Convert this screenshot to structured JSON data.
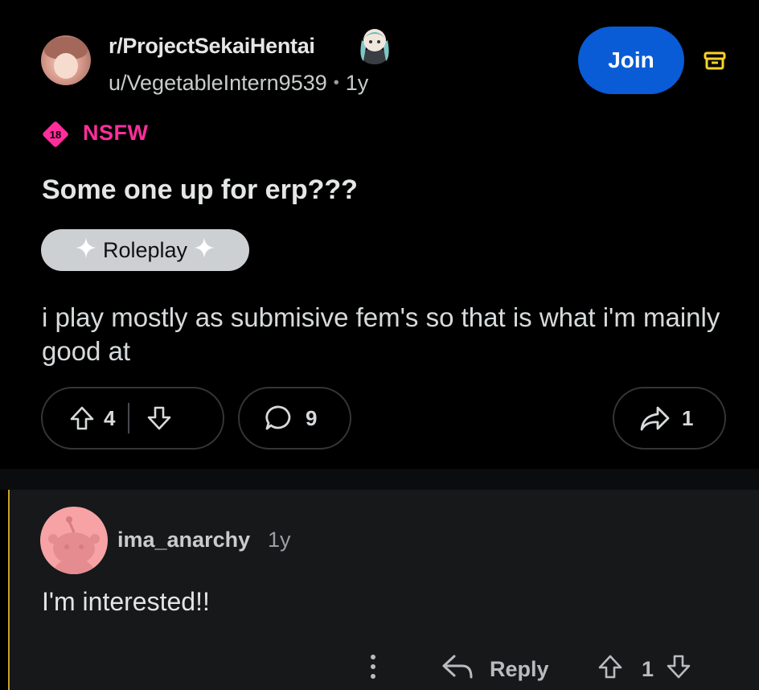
{
  "post": {
    "subreddit": "r/ProjectSekaiHentai",
    "author": "u/VegetableIntern9539",
    "separator": "•",
    "age": "1y",
    "join_label": "Join",
    "nsfw_badge": "18",
    "nsfw_label": "NSFW",
    "title": "Some one up for erp???",
    "flair": "Roleplay",
    "body": "i play mostly as submisive fem's so that is what i'm mainly good at",
    "upvotes": "4",
    "comments": "9",
    "shares": "1"
  },
  "comment": {
    "author": "ima_anarchy",
    "age": "1y",
    "text": "I'm interested!!",
    "more_label": "⋮",
    "reply_label": "Reply",
    "votes": "1"
  },
  "colors": {
    "background": "#000000",
    "join_button": "#0a5bd6",
    "nsfw": "#ff2e9a",
    "mod_icon": "#ffd027",
    "flair_bg": "#cdd0d3",
    "comment_bg": "#16181a",
    "thread_line": "#c9a227",
    "comment_avatar": "#f7a3a6"
  },
  "icons": [
    "subreddit-avatar",
    "mascot-icon",
    "mod-archive-icon",
    "nsfw-18-icon",
    "sparkle-icon",
    "upvote-icon",
    "downvote-icon",
    "comment-bubble-icon",
    "share-arrow-icon",
    "snoo-avatar",
    "more-vertical-icon",
    "reply-arrow-icon"
  ]
}
